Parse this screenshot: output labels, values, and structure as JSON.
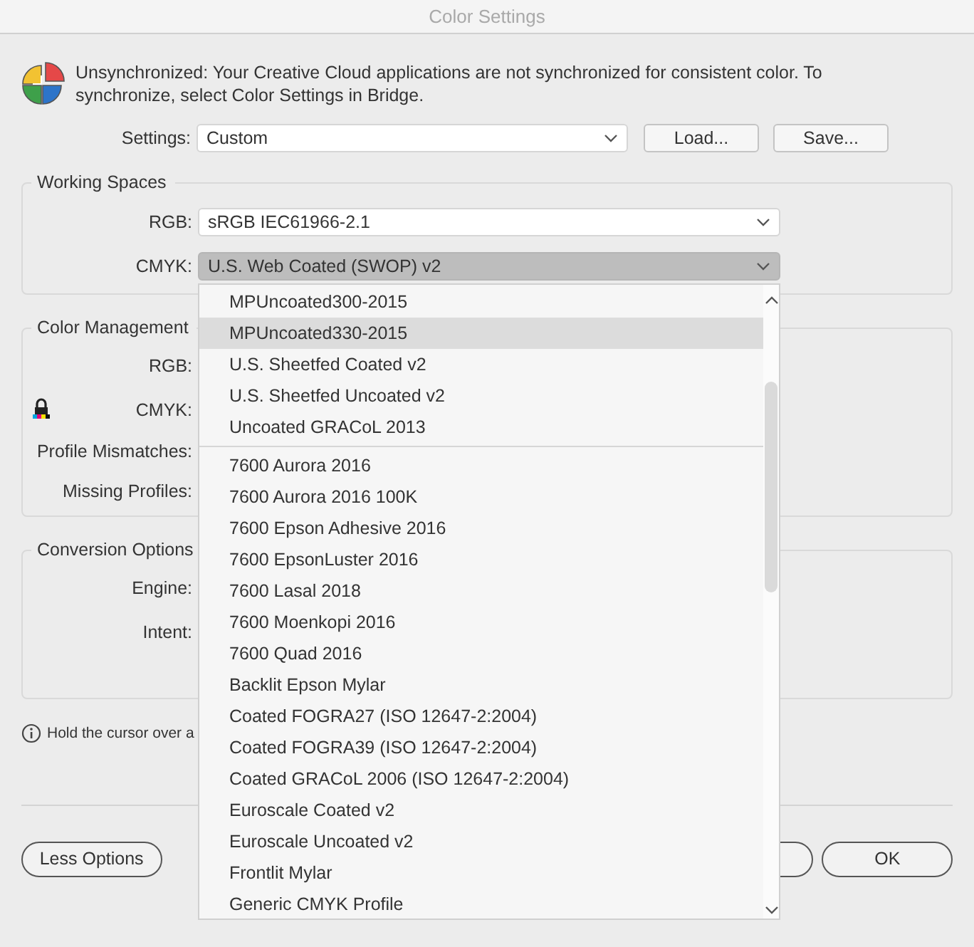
{
  "window": {
    "title": "Color Settings"
  },
  "sync_message": "Unsynchronized: Your Creative Cloud applications are not synchronized for consistent color. To synchronize, select Color Settings in Bridge.",
  "settings": {
    "label": "Settings:",
    "value": "Custom",
    "buttons": [
      "Load...",
      "Save..."
    ]
  },
  "working_spaces": {
    "title": "Working Spaces",
    "rows": [
      {
        "label": "RGB:",
        "value": "sRGB IEC61966-2.1",
        "expanded": false
      },
      {
        "label": "CMYK:",
        "value": "U.S. Web Coated (SWOP) v2",
        "expanded": true
      }
    ]
  },
  "color_management_policies": {
    "title": "Color Management",
    "labels": [
      {
        "text": "RGB:",
        "locked": false
      },
      {
        "text": "CMYK:",
        "locked": true
      },
      {
        "text": "Profile Mismatches:",
        "locked": false
      },
      {
        "text": "Missing Profiles:",
        "locked": false
      }
    ]
  },
  "conversion_options": {
    "title": "Conversion Options",
    "labels": [
      "Engine:",
      "Intent:"
    ]
  },
  "info": "Hold the cursor over a",
  "buttons": {
    "less_options": "Less Options",
    "ok": "OK"
  },
  "dropdown": {
    "items": [
      {
        "kind": "item",
        "label": "MPUncoated300-2015",
        "selected": false
      },
      {
        "kind": "item",
        "label": "MPUncoated330-2015",
        "selected": true
      },
      {
        "kind": "item",
        "label": "U.S. Sheetfed Coated v2",
        "selected": false
      },
      {
        "kind": "item",
        "label": "U.S. Sheetfed Uncoated v2",
        "selected": false
      },
      {
        "kind": "item",
        "label": "Uncoated GRACoL 2013",
        "selected": false
      },
      {
        "kind": "separator"
      },
      {
        "kind": "item",
        "label": "7600 Aurora 2016",
        "selected": false
      },
      {
        "kind": "item",
        "label": "7600 Aurora 2016 100K",
        "selected": false
      },
      {
        "kind": "item",
        "label": "7600 Epson Adhesive 2016",
        "selected": false
      },
      {
        "kind": "item",
        "label": "7600 EpsonLuster 2016",
        "selected": false
      },
      {
        "kind": "item",
        "label": "7600 Lasal 2018",
        "selected": false
      },
      {
        "kind": "item",
        "label": "7600 Moenkopi 2016",
        "selected": false
      },
      {
        "kind": "item",
        "label": "7600 Quad 2016",
        "selected": false
      },
      {
        "kind": "item",
        "label": "Backlit Epson Mylar",
        "selected": false
      },
      {
        "kind": "item",
        "label": "Coated FOGRA27 (ISO 12647-2:2004)",
        "selected": false
      },
      {
        "kind": "item",
        "label": "Coated FOGRA39 (ISO 12647-2:2004)",
        "selected": false
      },
      {
        "kind": "item",
        "label": "Coated GRACoL 2006 (ISO 12647-2:2004)",
        "selected": false
      },
      {
        "kind": "item",
        "label": "Euroscale Coated v2",
        "selected": false
      },
      {
        "kind": "item",
        "label": "Euroscale Uncoated v2",
        "selected": false
      },
      {
        "kind": "item",
        "label": "Frontlit Mylar",
        "selected": false
      },
      {
        "kind": "item",
        "label": "Generic CMYK Profile",
        "selected": false
      }
    ]
  }
}
